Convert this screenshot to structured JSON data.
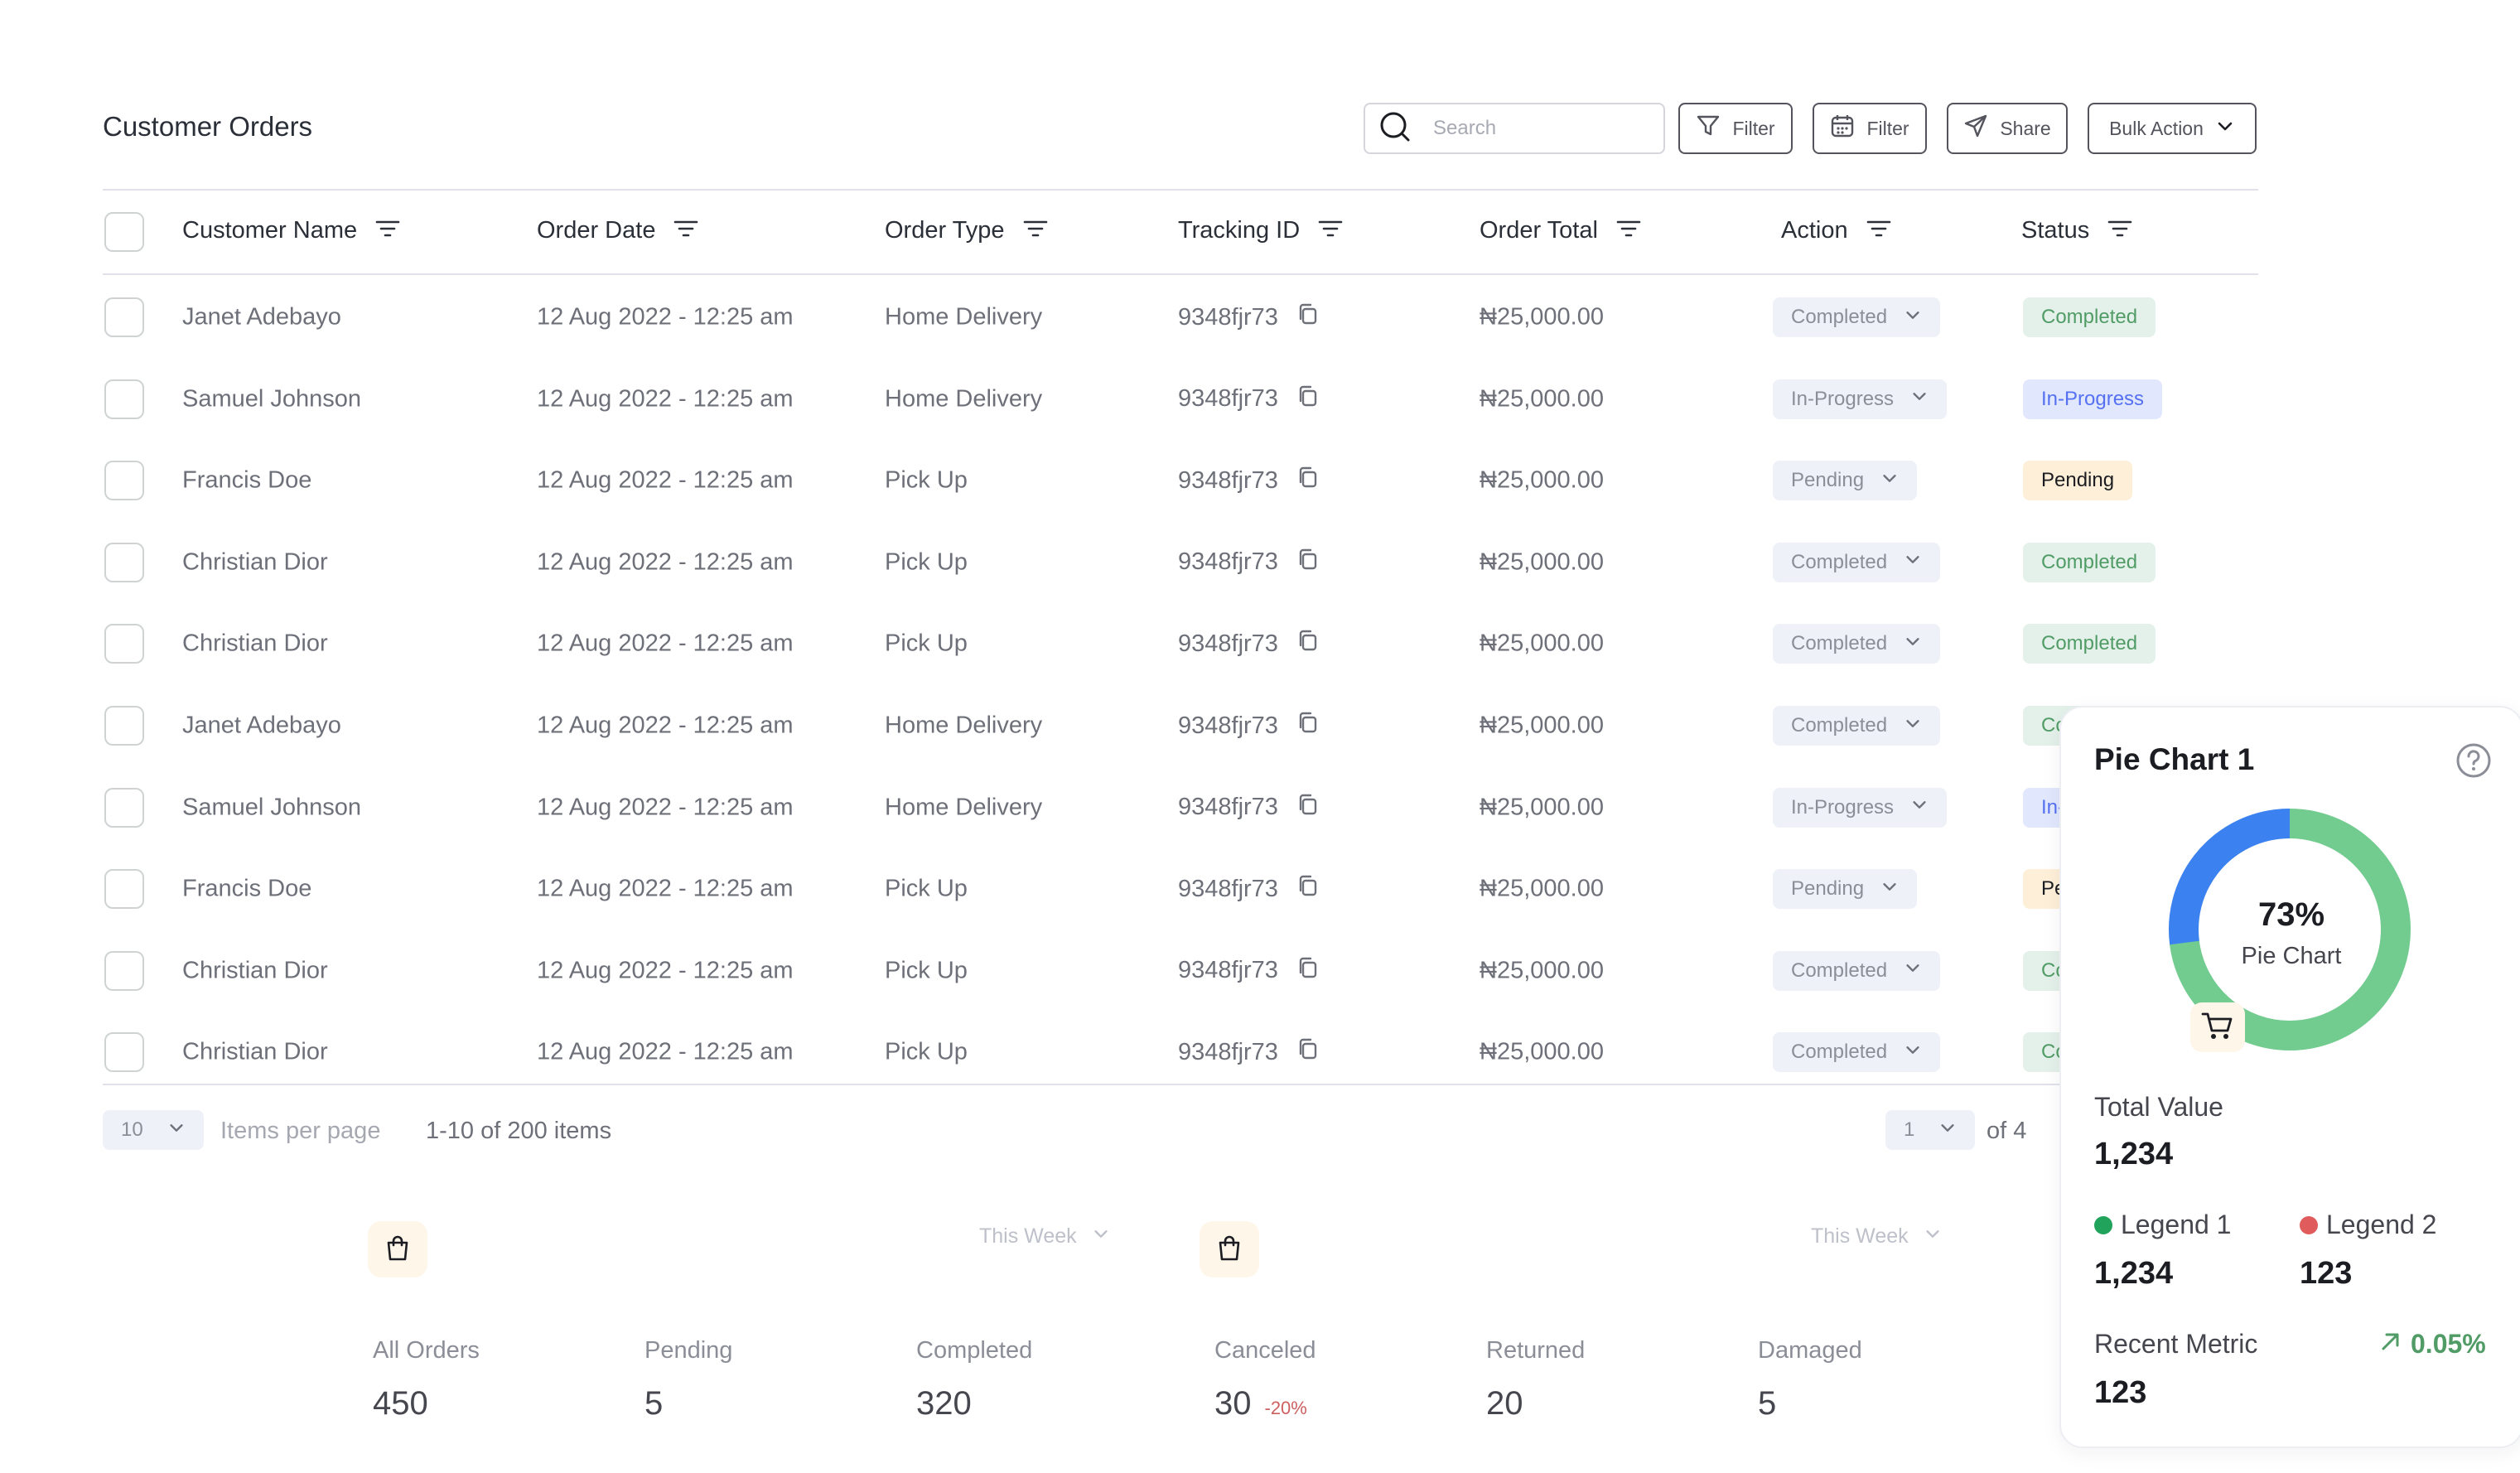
{
  "header": {
    "title": "Customer Orders",
    "search_placeholder": "Search",
    "filter_label": "Filter",
    "date_filter_label": "Filter",
    "share_label": "Share",
    "bulk_action_label": "Bulk Action"
  },
  "table": {
    "columns": [
      "Customer Name",
      "Order Date",
      "Order Type",
      "Tracking ID",
      "Order Total",
      "Action",
      "Status"
    ],
    "rows": [
      {
        "customer": "Janet Adebayo",
        "date": "12 Aug 2022 - 12:25 am",
        "type": "Home Delivery",
        "tracking": "9348fjr73",
        "total": "₦25,000.00",
        "action": "Completed",
        "status": "Completed"
      },
      {
        "customer": "Samuel Johnson",
        "date": "12 Aug 2022 - 12:25 am",
        "type": "Home Delivery",
        "tracking": "9348fjr73",
        "total": "₦25,000.00",
        "action": "In-Progress",
        "status": "In-Progress"
      },
      {
        "customer": "Francis Doe",
        "date": "12 Aug 2022 - 12:25 am",
        "type": "Pick Up",
        "tracking": "9348fjr73",
        "total": "₦25,000.00",
        "action": "Pending",
        "status": "Pending"
      },
      {
        "customer": "Christian Dior",
        "date": "12 Aug 2022 - 12:25 am",
        "type": "Pick Up",
        "tracking": "9348fjr73",
        "total": "₦25,000.00",
        "action": "Completed",
        "status": "Completed"
      },
      {
        "customer": "Christian Dior",
        "date": "12 Aug 2022 - 12:25 am",
        "type": "Pick Up",
        "tracking": "9348fjr73",
        "total": "₦25,000.00",
        "action": "Completed",
        "status": "Completed"
      },
      {
        "customer": "Janet Adebayo",
        "date": "12 Aug 2022 - 12:25 am",
        "type": "Home Delivery",
        "tracking": "9348fjr73",
        "total": "₦25,000.00",
        "action": "Completed",
        "status": "Completed"
      },
      {
        "customer": "Samuel Johnson",
        "date": "12 Aug 2022 - 12:25 am",
        "type": "Home Delivery",
        "tracking": "9348fjr73",
        "total": "₦25,000.00",
        "action": "In-Progress",
        "status": "In-Progress"
      },
      {
        "customer": "Francis Doe",
        "date": "12 Aug 2022 - 12:25 am",
        "type": "Pick Up",
        "tracking": "9348fjr73",
        "total": "₦25,000.00",
        "action": "Pending",
        "status": "Pending"
      },
      {
        "customer": "Christian Dior",
        "date": "12 Aug 2022 - 12:25 am",
        "type": "Pick Up",
        "tracking": "9348fjr73",
        "total": "₦25,000.00",
        "action": "Completed",
        "status": "Completed"
      },
      {
        "customer": "Christian Dior",
        "date": "12 Aug 2022 - 12:25 am",
        "type": "Pick Up",
        "tracking": "9348fjr73",
        "total": "₦25,000.00",
        "action": "Completed",
        "status": "Completed"
      }
    ]
  },
  "pagination": {
    "per_page_value": "10",
    "per_page_label": "Items per page",
    "range_text": "1-10 of 200 items",
    "page_value": "1",
    "of_pages": "of 4"
  },
  "summary": {
    "period_left": "This Week",
    "period_right": "This Week",
    "stats": [
      {
        "label": "All Orders",
        "value": "450"
      },
      {
        "label": "Pending",
        "value": "5"
      },
      {
        "label": "Completed",
        "value": "320"
      },
      {
        "label": "Canceled",
        "value": "30",
        "delta": "-20%"
      },
      {
        "label": "Returned",
        "value": "20"
      },
      {
        "label": "Damaged",
        "value": "5"
      }
    ]
  },
  "pie_card": {
    "title": "Pie Chart 1",
    "center_value": "73%",
    "center_label": "Pie Chart",
    "total_label": "Total Value",
    "total_value": "1,234",
    "legend1_label": "Legend 1",
    "legend1_value": "1,234",
    "legend2_label": "Legend 2",
    "legend2_value": "123",
    "recent_label": "Recent Metric",
    "recent_value": "123",
    "recent_change": "0.05%",
    "colors": {
      "primary": "#72cc8f",
      "secondary": "#3b82f0",
      "legend1": "#22a35c",
      "legend2": "#e05b5b"
    }
  },
  "chart_data": {
    "type": "pie",
    "categories": [
      "Green",
      "Blue"
    ],
    "values": [
      73,
      27
    ]
  },
  "colors": {
    "completed_bg": "#e4f1ea",
    "completed_fg": "#519c66",
    "progress_bg": "#e1e8fd",
    "progress_fg": "#5570f1",
    "pending_bg": "#feefd8",
    "pending_fg": "#1c1d22"
  }
}
